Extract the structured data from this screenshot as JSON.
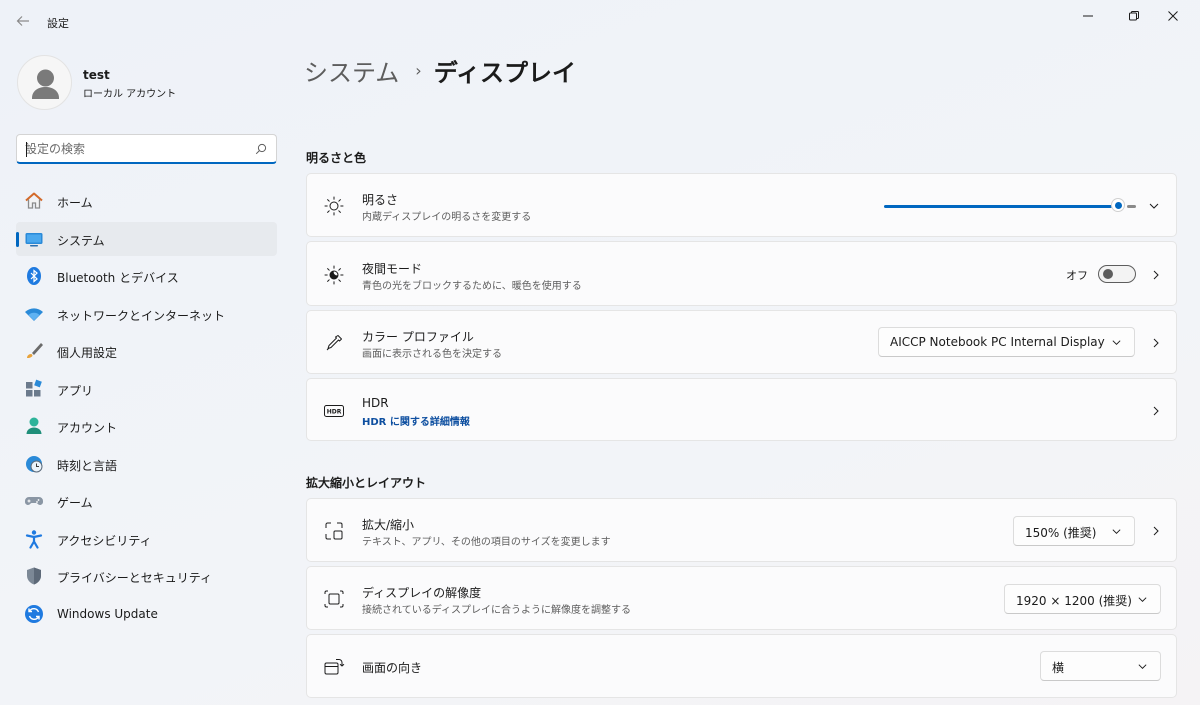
{
  "window": {
    "title": "設定",
    "back_icon": "back-arrow-icon",
    "controls": [
      "minimize-icon",
      "restore-icon",
      "close-icon"
    ]
  },
  "profile": {
    "name": "test",
    "account_type": "ローカル アカウント"
  },
  "search": {
    "placeholder": "設定の検索",
    "value": ""
  },
  "sidebar": {
    "items": [
      {
        "label": "ホーム",
        "icon": "home-icon"
      },
      {
        "label": "システム",
        "icon": "system-icon",
        "active": true
      },
      {
        "label": "Bluetooth とデバイス",
        "icon": "bluetooth-icon"
      },
      {
        "label": "ネットワークとインターネット",
        "icon": "wifi-icon"
      },
      {
        "label": "個人用設定",
        "icon": "brush-icon"
      },
      {
        "label": "アプリ",
        "icon": "apps-icon"
      },
      {
        "label": "アカウント",
        "icon": "account-icon"
      },
      {
        "label": "時刻と言語",
        "icon": "clock-globe-icon"
      },
      {
        "label": "ゲーム",
        "icon": "gamepad-icon"
      },
      {
        "label": "アクセシビリティ",
        "icon": "accessibility-icon"
      },
      {
        "label": "プライバシーとセキュリティ",
        "icon": "shield-icon"
      },
      {
        "label": "Windows Update",
        "icon": "windows-update-icon"
      }
    ]
  },
  "breadcrumb": {
    "parent": "システム",
    "separator": "›",
    "current": "ディスプレイ"
  },
  "sections": {
    "brightness_color": {
      "header": "明るさと色",
      "brightness": {
        "title": "明るさ",
        "desc": "内蔵ディスプレイの明るさを変更する",
        "value_fraction": 0.93
      },
      "night_light": {
        "title": "夜間モード",
        "desc": "青色の光をブロックするために、暖色を使用する",
        "toggle_label": "オフ",
        "on": false
      },
      "color_profile": {
        "title": "カラー プロファイル",
        "desc": "画面に表示される色を決定する",
        "selected": "AICCP Notebook PC Internal Display"
      },
      "hdr": {
        "title": "HDR",
        "link": "HDR に関する詳細情報"
      }
    },
    "scale_layout": {
      "header": "拡大縮小とレイアウト",
      "scale": {
        "title": "拡大/縮小",
        "desc": "テキスト、アプリ、その他の項目のサイズを変更します",
        "selected": "150% (推奨)"
      },
      "resolution": {
        "title": "ディスプレイの解像度",
        "desc": "接続されているディスプレイに合うように解像度を調整する",
        "selected": "1920 × 1200 (推奨)"
      },
      "orientation": {
        "title": "画面の向き",
        "selected": "横"
      }
    }
  },
  "colors": {
    "accent": "#0067c0",
    "link": "#0e4fa0"
  }
}
